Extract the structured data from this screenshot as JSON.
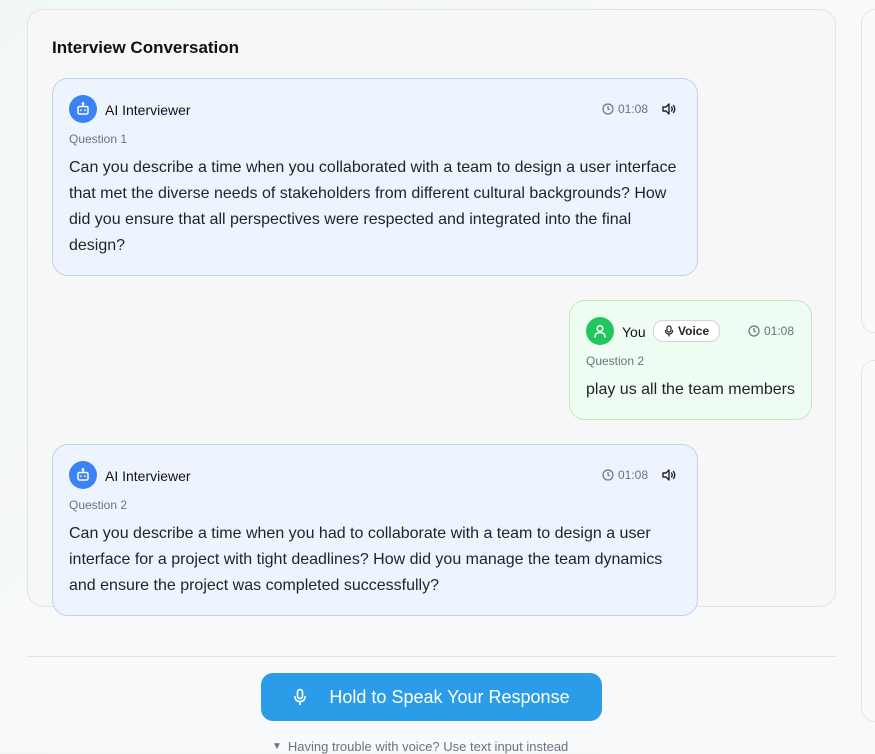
{
  "conversation": {
    "title": "Interview Conversation",
    "messages": [
      {
        "sender": "AI Interviewer",
        "question_label": "Question 1",
        "time": "01:08",
        "text": "Can you describe a time when you collaborated with a team to design a user interface that met the diverse needs of stakeholders from different cultural backgrounds? How did you ensure that all perspectives were respected and integrated into the final design?"
      },
      {
        "sender": "You",
        "badge": "Voice",
        "question_label": "Question 2",
        "time": "01:08",
        "text": "play us all the team members"
      },
      {
        "sender": "AI Interviewer",
        "question_label": "Question 2",
        "time": "01:08",
        "text": "Can you describe a time when you had to collaborate with a team to design a user interface for a project with tight deadlines? How did you manage the team dynamics and ensure the project was completed successfully?"
      }
    ]
  },
  "controls": {
    "speak_button_label": "Hold to Speak Your Response",
    "fallback_text": "Having trouble with voice? Use text input instead",
    "fallback_arrow": "▼"
  },
  "colors": {
    "ai_accent": "#3b82f6",
    "user_accent": "#22c55e",
    "speak_button": "#2b9de8"
  },
  "icons": {
    "ai_avatar": "bot-icon",
    "user_avatar": "user-icon",
    "time": "clock-icon",
    "audio": "speaker-icon",
    "voice_badge": "mic-icon",
    "speak_button": "mic-icon"
  }
}
